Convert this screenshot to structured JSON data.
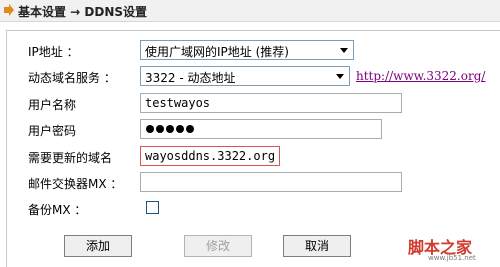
{
  "breadcrumb": "基本设置 → DDNS设置",
  "form": {
    "ip_label": "IP地址 ：",
    "ip_select": "使用广域网的IP地址 (推荐)",
    "ddns_label": "动态域名服务 ：",
    "ddns_select": "3322 - 动态地址",
    "ddns_link": "http://www.3322.org/",
    "username_label": "用户名称",
    "username_value": "testwayos",
    "password_label": "用户密码",
    "password_length": 5,
    "domain_label": "需要更新的域名",
    "domain_value": "wayosddns.3322.org",
    "mx_label": "邮件交换器MX ：",
    "mx_value": "",
    "backup_mx_label": "备份MX ：",
    "backup_mx_checked": false
  },
  "buttons": {
    "add": "添加",
    "modify": "修改",
    "cancel": "取消"
  },
  "watermark": {
    "logo": "脚本之家",
    "url": "www.jb51.net"
  },
  "colors": {
    "link": "#800080",
    "highlight_border": "#d9534f",
    "watermark": "#d13b2e"
  }
}
